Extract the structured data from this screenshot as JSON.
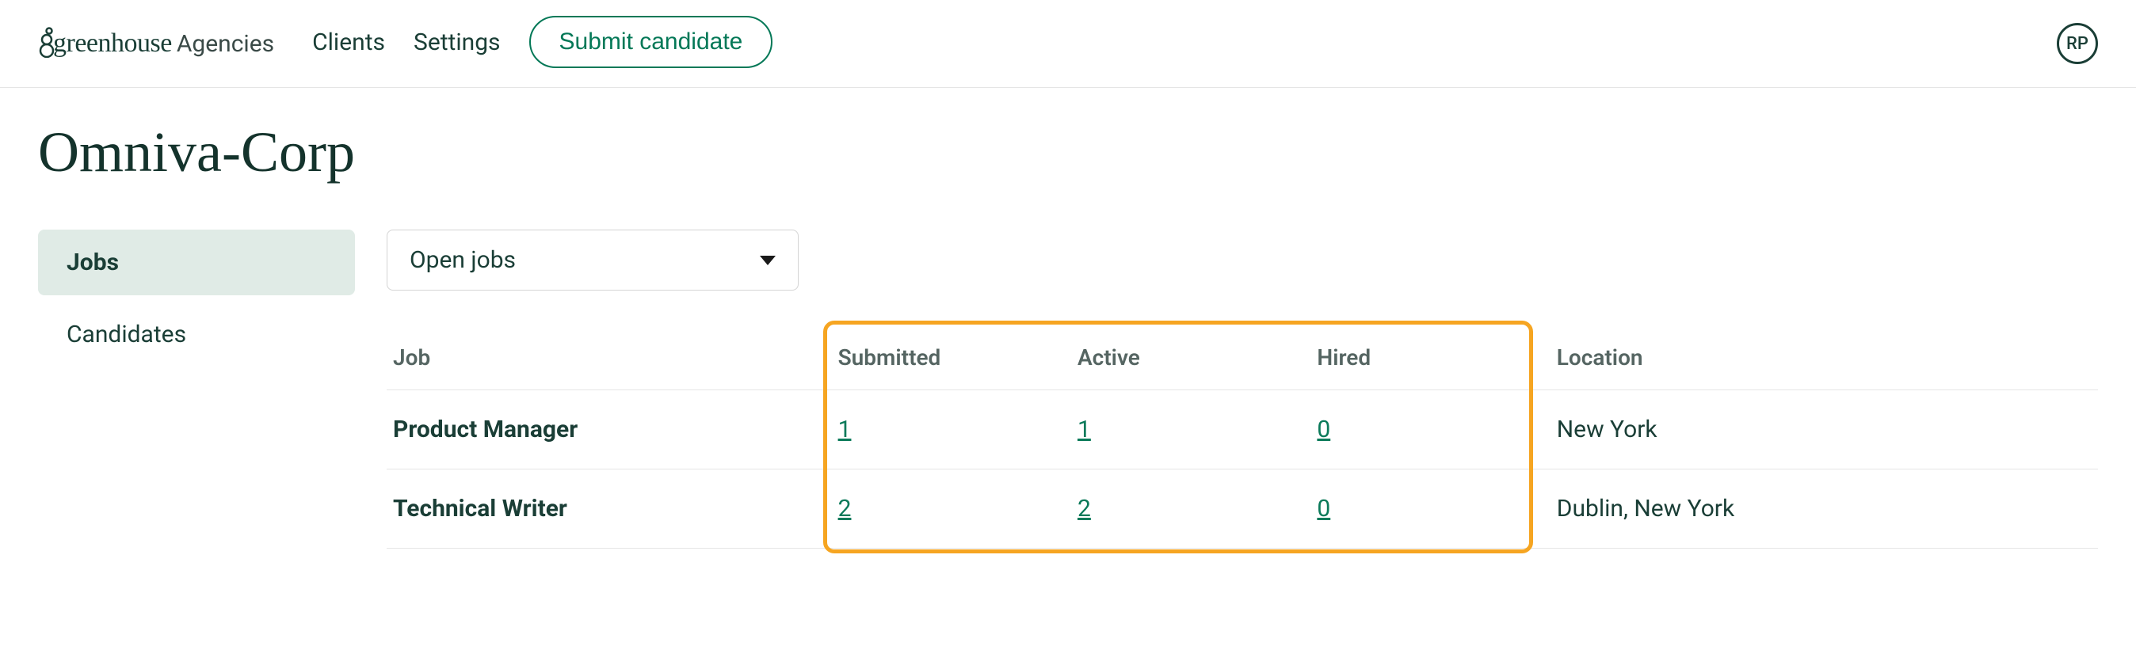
{
  "header": {
    "logo_main": "greenhouse",
    "logo_sub": "Agencies",
    "nav": {
      "clients": "Clients",
      "settings": "Settings"
    },
    "submit_label": "Submit candidate",
    "avatar_initials": "RP"
  },
  "page": {
    "title": "Omniva-Corp"
  },
  "tabs": {
    "jobs": "Jobs",
    "candidates": "Candidates"
  },
  "filter": {
    "selected": "Open jobs"
  },
  "table": {
    "headers": {
      "job": "Job",
      "submitted": "Submitted",
      "active": "Active",
      "hired": "Hired",
      "location": "Location"
    },
    "rows": [
      {
        "job": "Product Manager",
        "submitted": "1",
        "active": "1",
        "hired": "0",
        "location": "New York"
      },
      {
        "job": "Technical Writer",
        "submitted": "2",
        "active": "2",
        "hired": "0",
        "location": "Dublin, New York"
      }
    ]
  }
}
